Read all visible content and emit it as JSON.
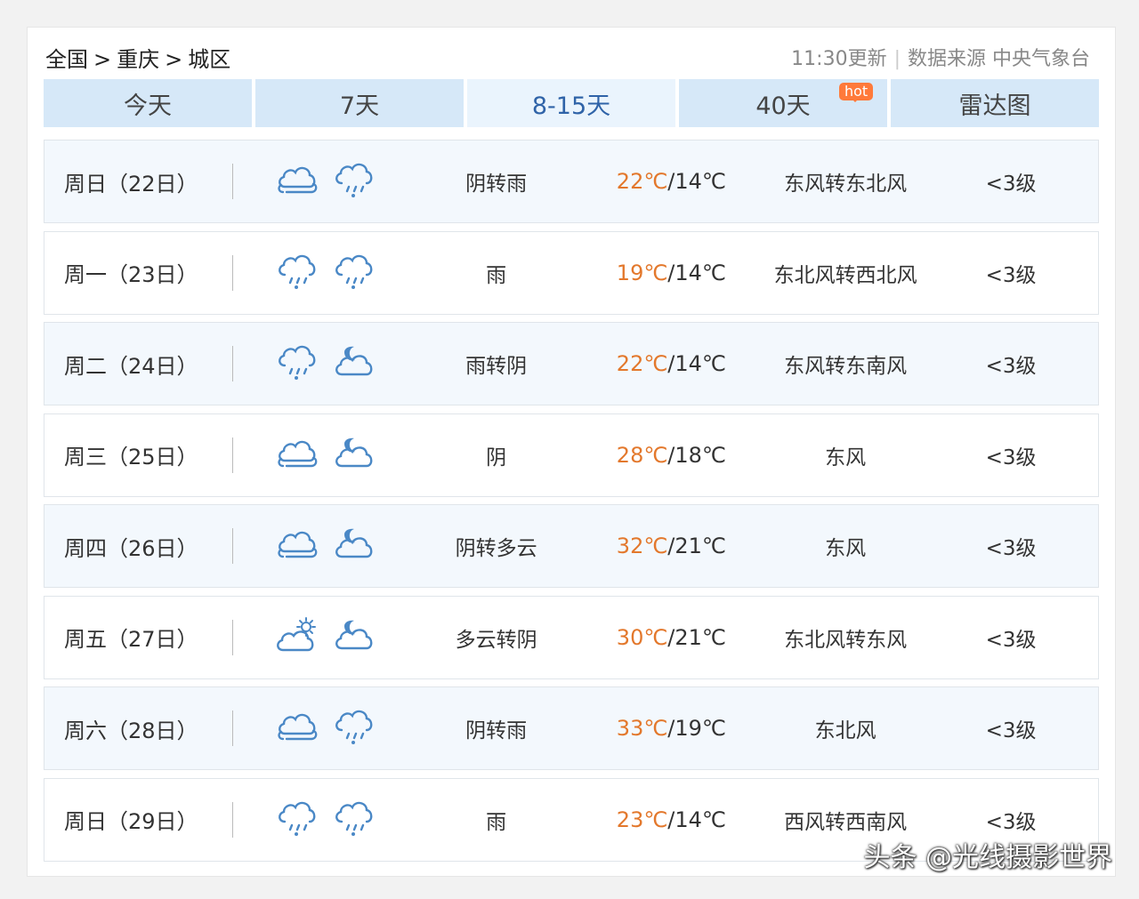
{
  "breadcrumb": [
    "全国",
    "重庆",
    "城区"
  ],
  "breadcrumb_sep": ">",
  "meta": {
    "update": "11:30更新",
    "source": "数据来源 中央气象台"
  },
  "tabs": [
    {
      "label": "今天"
    },
    {
      "label": "7天"
    },
    {
      "label": "8-15天"
    },
    {
      "label": "40天",
      "badge": "hot"
    },
    {
      "label": "雷达图"
    }
  ],
  "rows": [
    {
      "day": "周日（22日）",
      "icons": [
        "cloud-icon",
        "rain-icon"
      ],
      "desc": "阴转雨",
      "hi": "22℃",
      "lo": "/14℃",
      "wind": "东风转东北风",
      "level": "<3级"
    },
    {
      "day": "周一（23日）",
      "icons": [
        "rain-icon",
        "rain-icon"
      ],
      "desc": "雨",
      "hi": "19℃",
      "lo": "/14℃",
      "wind": "东北风转西北风",
      "level": "<3级"
    },
    {
      "day": "周二（24日）",
      "icons": [
        "rain-icon",
        "moon-cloud-icon"
      ],
      "desc": "雨转阴",
      "hi": "22℃",
      "lo": "/14℃",
      "wind": "东风转东南风",
      "level": "<3级"
    },
    {
      "day": "周三（25日）",
      "icons": [
        "cloud-icon",
        "moon-cloud-icon"
      ],
      "desc": "阴",
      "hi": "28℃",
      "lo": "/18℃",
      "wind": "东风",
      "level": "<3级"
    },
    {
      "day": "周四（26日）",
      "icons": [
        "cloud-icon",
        "moon-cloud-icon"
      ],
      "desc": "阴转多云",
      "hi": "32℃",
      "lo": "/21℃",
      "wind": "东风",
      "level": "<3级"
    },
    {
      "day": "周五（27日）",
      "icons": [
        "sun-cloud-icon",
        "moon-cloud-icon"
      ],
      "desc": "多云转阴",
      "hi": "30℃",
      "lo": "/21℃",
      "wind": "东北风转东风",
      "level": "<3级"
    },
    {
      "day": "周六（28日）",
      "icons": [
        "cloud-icon",
        "rain-icon"
      ],
      "desc": "阴转雨",
      "hi": "33℃",
      "lo": "/19℃",
      "wind": "东北风",
      "level": "<3级"
    },
    {
      "day": "周日（29日）",
      "icons": [
        "rain-icon",
        "rain-icon"
      ],
      "desc": "雨",
      "hi": "23℃",
      "lo": "/14℃",
      "wind": "西风转西南风",
      "level": "<3级"
    }
  ],
  "watermark": "头条 @光线摄影世界",
  "colors": {
    "tab_bg": "#d6e8f8",
    "tab_active_text": "#2f63a8",
    "temp_high": "#e3782c",
    "hot_badge": "#ff7a3a",
    "icon_blue": "#4a88c6"
  }
}
